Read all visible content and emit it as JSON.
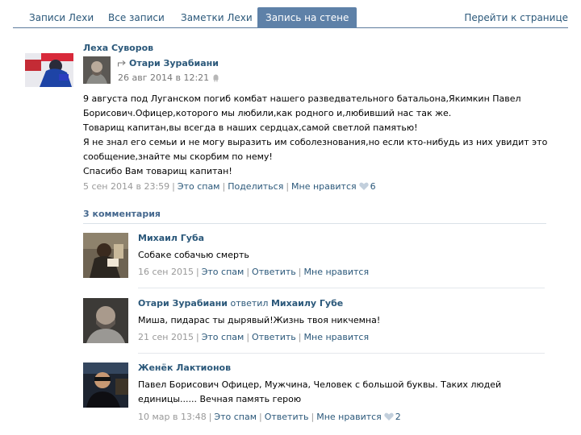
{
  "tabs": {
    "items": [
      "Записи Лехи",
      "Все записи",
      "Заметки Лехи",
      "Запись на стене"
    ],
    "right": "Перейти к странице"
  },
  "post": {
    "author": "Леха Суворов",
    "repost_author": "Отари Зурабиани",
    "repost_date": "26 авг 2014 в 12:21",
    "text": [
      "9 августа под Луганском погиб комбат нашего разведвательного батальона,Якимкин Павел",
      "Борисович.Офицер,которого мы любили,как родного и,любивший нас так же.",
      "Товарищ капитан,вы всегда в наших сердцах,самой светлой памятью!",
      "Я не знал его семьи и не могу выразить им соболезнования,но если кто-нибудь из них увидит это",
      "сообщение,знайте мы скорбим по нему!",
      "Спасибо Вам товарищ капитан!"
    ],
    "date": "5 сен 2014 в 23:59",
    "spam": "Это спам",
    "share": "Поделиться",
    "like": "Мне нравится",
    "like_count": "6"
  },
  "comments_header": "3 комментария",
  "comments": [
    {
      "author": "Михаил Губа",
      "reply_text": "",
      "reply_to": "",
      "text": [
        "Собаке собачью смерть"
      ],
      "date": "16 сен 2015",
      "spam": "Это спам",
      "reply": "Ответить",
      "like": "Мне нравится",
      "like_count": ""
    },
    {
      "author": "Отари Зурабиани",
      "reply_text": "ответил",
      "reply_to": "Михаилу Губе",
      "text": [
        "Миша, пидарас ты дырявый!Жизнь твоя никчемна!"
      ],
      "date": "21 сен 2015",
      "spam": "Это спам",
      "reply": "Ответить",
      "like": "Мне нравится",
      "like_count": ""
    },
    {
      "author": "Женёк Лактионов",
      "reply_text": "",
      "reply_to": "",
      "text": [
        "Павел Борисович Офицер, Мужчина, Человек с большой буквы. Таких людей",
        "единицы...... Вечная память герою"
      ],
      "date": "10 мар в 13:48",
      "spam": "Это спам",
      "reply": "Ответить",
      "like": "Мне нравится",
      "like_count": "2"
    }
  ],
  "colors": {
    "link": "#2b587a",
    "tab_active": "#5e81a8",
    "muted": "#999999"
  }
}
